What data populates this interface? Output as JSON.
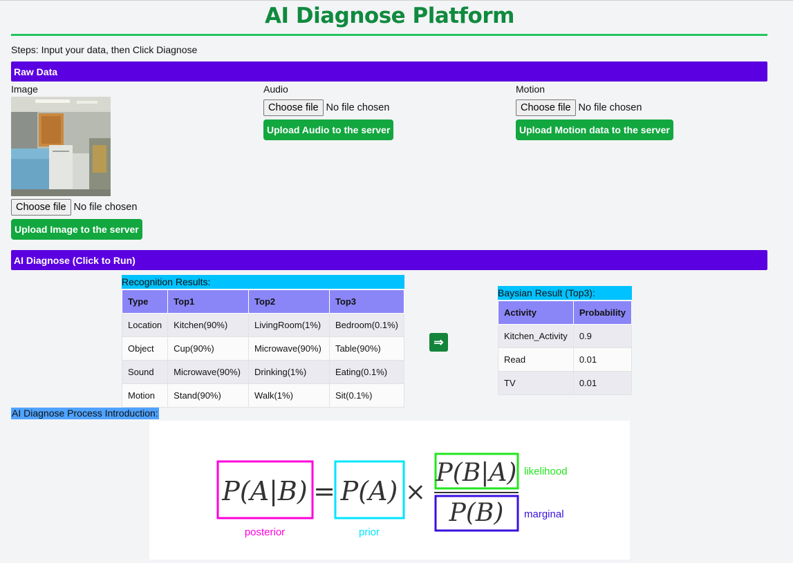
{
  "header": {
    "title": "AI Diagnose Platform",
    "steps": "Steps: Input your data, then Click Diagnose"
  },
  "raw_data": {
    "bar_label": "Raw Data",
    "image": {
      "label": "Image",
      "choose": "Choose file",
      "status": "No file chosen",
      "upload": "Upload Image to the server"
    },
    "audio": {
      "label": "Audio",
      "choose": "Choose file",
      "status": "No file chosen",
      "upload": "Upload Audio to the server"
    },
    "motion": {
      "label": "Motion",
      "choose": "Choose file",
      "status": "No file chosen",
      "upload": "Upload Motion data to the server"
    }
  },
  "diagnose": {
    "bar_label": "AI Diagnose (Click to Run)",
    "arrow": "⇒",
    "recognition": {
      "caption": "Recognition Results:",
      "headers": [
        "Type",
        "Top1",
        "Top2",
        "Top3"
      ],
      "rows": [
        [
          "Location",
          "Kitchen(90%)",
          "LivingRoom(1%)",
          "Bedroom(0.1%)"
        ],
        [
          "Object",
          "Cup(90%)",
          "Microwave(90%)",
          "Table(90%)"
        ],
        [
          "Sound",
          "Microwave(90%)",
          "Drinking(1%)",
          "Eating(0.1%)"
        ],
        [
          "Motion",
          "Stand(90%)",
          "Walk(1%)",
          "Sit(0.1%)"
        ]
      ]
    },
    "bayesian": {
      "caption": "Baysian Result (Top3):",
      "headers": [
        "Activity",
        "Probability"
      ],
      "rows": [
        [
          "Kitchen_Activity",
          "0.9"
        ],
        [
          "Read",
          "0.01"
        ],
        [
          "TV",
          "0.01"
        ]
      ]
    }
  },
  "intro": {
    "label": "AI Diagnose Process Introduction:",
    "formula": {
      "lhs": "P(A|B)",
      "equals": "=",
      "prior_term": "P(A)",
      "times": "×",
      "numerator": "P(B|A)",
      "denominator": "P(B)",
      "posterior_label": "posterior",
      "prior_label": "prior",
      "likelihood_label": "likelihood",
      "marginal_label": "marginal",
      "colors": {
        "posterior": "#ff00dd",
        "prior": "#00e5ff",
        "likelihood": "#22e61e",
        "marginal": "#3a10e0"
      }
    }
  }
}
